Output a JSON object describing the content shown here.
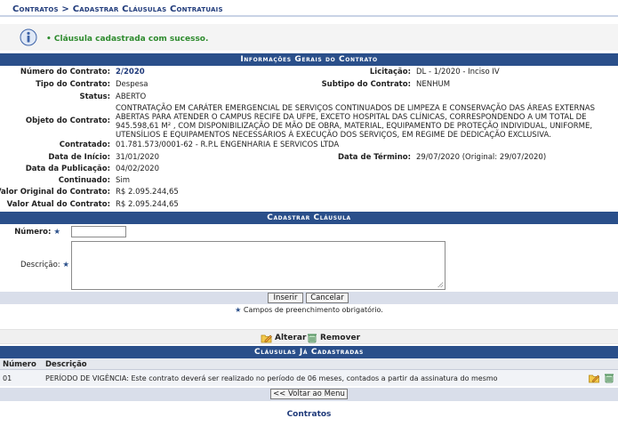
{
  "breadcrumb": "Contratos > Cadastrar Cláusulas Contratuais",
  "message": "• Cláusula cadastrada com sucesso.",
  "info_section": {
    "title": "Informações Gerais do Contrato",
    "numero_label": "Número do Contrato:",
    "numero_value": "2/2020",
    "licitacao_label": "Licitação:",
    "licitacao_value": "DL - 1/2020 - Inciso IV",
    "tipo_label": "Tipo do Contrato:",
    "tipo_value": "Despesa",
    "subtipo_label": "Subtipo do Contrato:",
    "subtipo_value": "NENHUM",
    "status_label": "Status:",
    "status_value": "ABERTO",
    "objeto_label": "Objeto do Contrato:",
    "objeto_value": "CONTRATAÇÃO EM CARÁTER EMERGENCIAL DE SERVIÇOS CONTINUADOS DE LIMPEZA E CONSERVAÇÃO DAS ÁREAS EXTERNAS ABERTAS PARA ATENDER O CAMPUS RECIFE DA UFPE, EXCETO HOSPITAL DAS CLÍNICAS, CORRESPONDENDO A UM TOTAL DE 945.598,61 M² , COM DISPONIBILIZAÇÃO DE MÃO DE OBRA, MATERIAL, EQUIPAMENTO DE PROTEÇÃO INDIVIDUAL, UNIFORME, UTENSÍLIOS E EQUIPAMENTOS NECESSÁRIOS À EXECUÇÃO DOS SERVIÇOS, EM REGIME DE DEDICAÇÃO EXCLUSIVA.",
    "contratado_label": "Contratado:",
    "contratado_value": "01.781.573/0001-62 - R.P.L ENGENHARIA E SERVICOS LTDA",
    "inicio_label": "Data de Início:",
    "inicio_value": "31/01/2020",
    "termino_label": "Data de Término:",
    "termino_value": "29/07/2020 (Original: 29/07/2020)",
    "publicacao_label": "Data da Publicação:",
    "publicacao_value": "04/02/2020",
    "continuado_label": "Continuado:",
    "continuado_value": "Sim",
    "valor_original_label": "Valor Original do Contrato:",
    "valor_original_value": "R$ 2.095.244,65",
    "valor_atual_label": "Valor Atual do Contrato:",
    "valor_atual_value": "R$ 2.095.244,65"
  },
  "form_section": {
    "title": "Cadastrar Cláusula",
    "numero_label": "Número:",
    "numero_value": "",
    "descricao_label": "Descrição:",
    "descricao_value": "",
    "required_mark": "★",
    "insert_label": "Inserir",
    "cancel_label": "Cancelar",
    "footnote": "Campos de preenchimento obrigatório."
  },
  "legend": {
    "alterar": "Alterar",
    "remover": "Remover"
  },
  "table_section": {
    "title": "Cláusulas Já Cadastradas",
    "columns": [
      "Número",
      "Descrição"
    ],
    "rows": [
      {
        "numero": "01",
        "descricao": "PERÍODO DE VIGÊNCIA: Este contrato deverá ser realizado no período de 06 meses, contados a partir da assinatura do mesmo"
      }
    ]
  },
  "back_label": "<< Voltar ao Menu",
  "footer_link": "Contratos",
  "colors": {
    "header_blue": "#2a4f8a",
    "link_blue": "#1f3a7a",
    "success_green": "#2e8b2e"
  }
}
